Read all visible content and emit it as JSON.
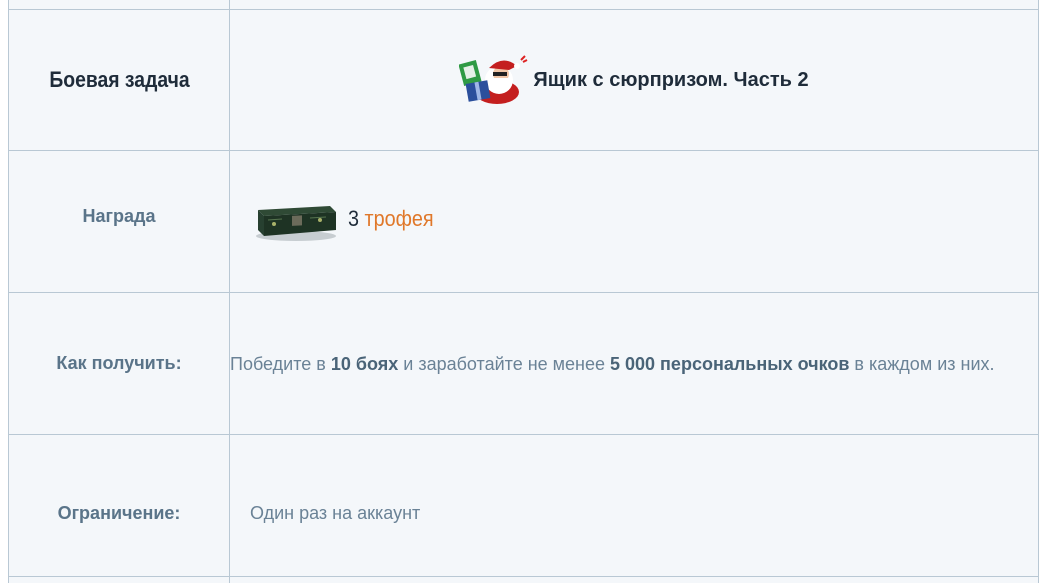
{
  "rows": {
    "mission": {
      "label": "Боевая задача",
      "icon": "santa-gift-icon",
      "name": "Ящик с сюрпризом. Часть 2"
    },
    "reward": {
      "label": "Награда",
      "icon": "military-box-icon",
      "count": "3",
      "item": "трофея",
      "item_color": "#e0782a"
    },
    "how": {
      "label": "Как получить:",
      "parts": {
        "p1": "Победите в ",
        "b1": "10 боях",
        "p2": " и заработайте не менее ",
        "b2": "5 000 персональных очков",
        "p3": " в каждом из них."
      }
    },
    "limit": {
      "label": "Ограничение:",
      "value": "Один раз на аккаунт"
    }
  },
  "colors": {
    "border": "#b9c8d4",
    "cell_bg": "#f4f7fa",
    "label_text": "#5a7489",
    "dark_text": "#1f2c3a",
    "body_text": "#6a8296",
    "accent": "#e0782a"
  }
}
